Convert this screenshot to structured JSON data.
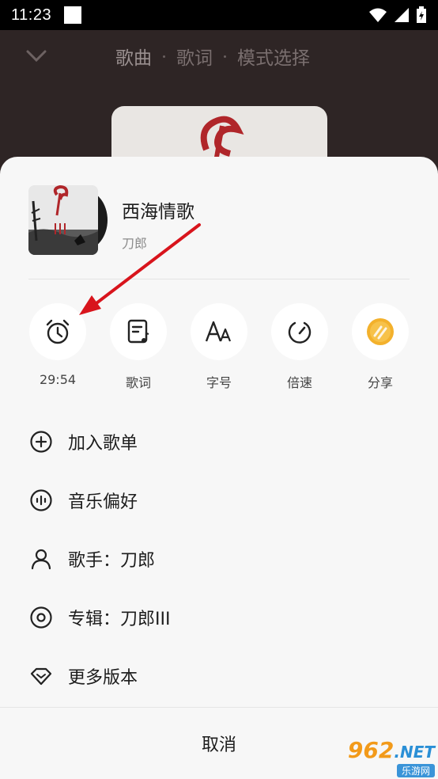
{
  "status_bar": {
    "time": "11:23"
  },
  "player": {
    "tabs": [
      {
        "label": "歌曲"
      },
      {
        "label": "歌词"
      },
      {
        "label": "模式选择"
      }
    ]
  },
  "sheet": {
    "song": {
      "title": "西海情歌",
      "artist": "刀郎"
    },
    "actions": [
      {
        "label": "29:54",
        "icon": "alarm-clock-icon"
      },
      {
        "label": "歌词",
        "icon": "lyrics-icon"
      },
      {
        "label": "字号",
        "icon": "font-size-icon"
      },
      {
        "label": "倍速",
        "icon": "speed-icon"
      },
      {
        "label": "分享",
        "icon": "share-icon"
      }
    ],
    "menu": [
      {
        "label": "加入歌单",
        "icon": "add-circle-icon"
      },
      {
        "label": "音乐偏好",
        "icon": "waveform-icon"
      },
      {
        "label": "歌手：刀郎",
        "icon": "person-icon"
      },
      {
        "label": "专辑：刀郎III",
        "icon": "album-disc-icon"
      },
      {
        "label": "更多版本",
        "icon": "diamond-icon"
      }
    ],
    "cancel_label": "取消"
  },
  "colors": {
    "accent_arrow": "#d8141c",
    "share_gold": "#f3b12c",
    "watermark_orange": "#f29a1a",
    "watermark_blue": "#3a94d8"
  },
  "watermark": {
    "brand": "962",
    "domain": ".NET",
    "sub": "乐游网"
  }
}
